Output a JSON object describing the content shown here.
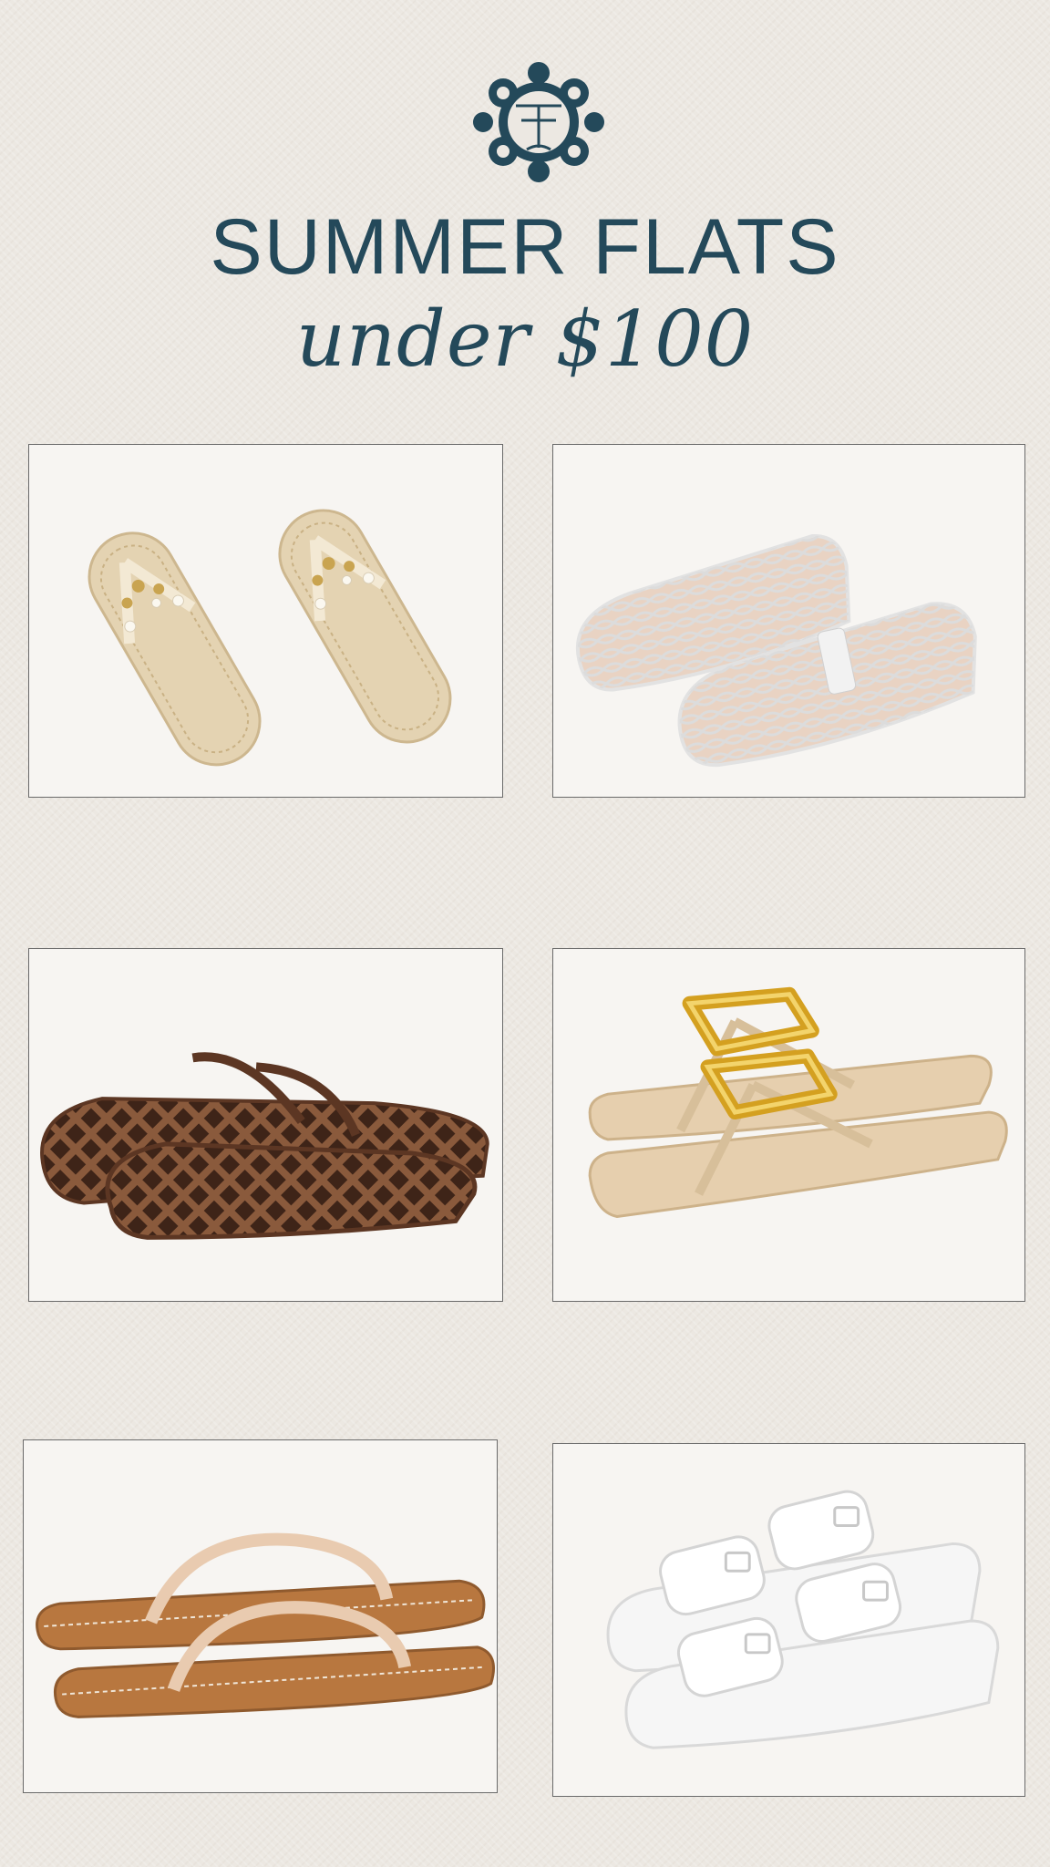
{
  "header": {
    "logo_icon": "ornamental-monogram-tt-logo",
    "logo_text": "T T",
    "title": "SUMMER FLATS",
    "subtitle": "under $100"
  },
  "colors": {
    "brand": "#24495a",
    "background": "#ece8e2",
    "card": "#f7f5f2"
  },
  "products": [
    {
      "name": "pearl-starfish-flip-flops"
    },
    {
      "name": "clear-mesh-mary-jane-flats"
    },
    {
      "name": "brown-jelly-mesh-mules"
    },
    {
      "name": "gold-chain-thong-sandals"
    },
    {
      "name": "tan-leather-flip-flops"
    },
    {
      "name": "white-double-buckle-slides"
    }
  ]
}
